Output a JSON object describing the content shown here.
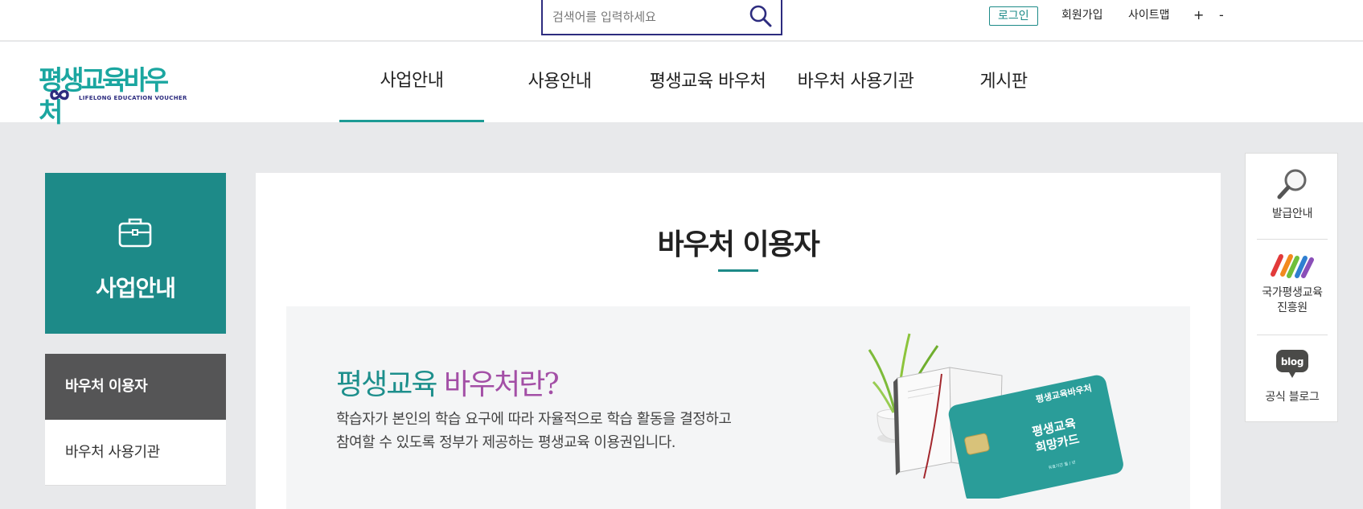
{
  "search": {
    "placeholder": "검색어를 입력하세요",
    "icon": "search-icon"
  },
  "utility": {
    "login": "로그인",
    "join": "회원가입",
    "sitemap": "사이트맵",
    "zoom_in": "+",
    "zoom_out": "-"
  },
  "logo": {
    "text": "평생교육바우처",
    "sub": "LIFELONG EDUCATION VOUCHER"
  },
  "nav": [
    {
      "label": "사업안내",
      "active": true
    },
    {
      "label": "사용안내",
      "active": false
    },
    {
      "label": "평생교육 바우처",
      "active": false
    },
    {
      "label": "바우처 사용기관",
      "active": false
    },
    {
      "label": "게시판",
      "active": false
    }
  ],
  "sidebar": {
    "title": "사업안내",
    "icon": "briefcase-icon",
    "items": [
      {
        "label": "바우처 이용자",
        "active": true
      },
      {
        "label": "바우처 사용기관",
        "active": false
      }
    ]
  },
  "content": {
    "page_title": "바우처 이용자",
    "intro": {
      "heading_a": "평생교육",
      "heading_b": "바우처란?",
      "desc_line1": "학습자가 본인의 학습 요구에 따라 자율적으로 학습 활동을 결정하고",
      "desc_line2": "참여할 수 있도록 정부가 제공하는 평생교육 이용권입니다."
    },
    "card": {
      "brand": "평생교육바우처",
      "title_line1": "평생교육",
      "title_line2": "희망카드",
      "date_label": "유효기간  월 / 년"
    }
  },
  "quick_menu": [
    {
      "label": "발급안내",
      "icon": "magnifier-icon"
    },
    {
      "label_line1": "국가평생교육",
      "label_line2": "진흥원",
      "icon": "nile-logo-icon"
    },
    {
      "label": "공식 블로그",
      "icon": "blog-icon",
      "icon_text": "blog"
    }
  ],
  "colors": {
    "teal": "#1d8a88",
    "navy": "#2d2c7f",
    "purple": "#a34fa6",
    "dark_gray": "#555556"
  }
}
